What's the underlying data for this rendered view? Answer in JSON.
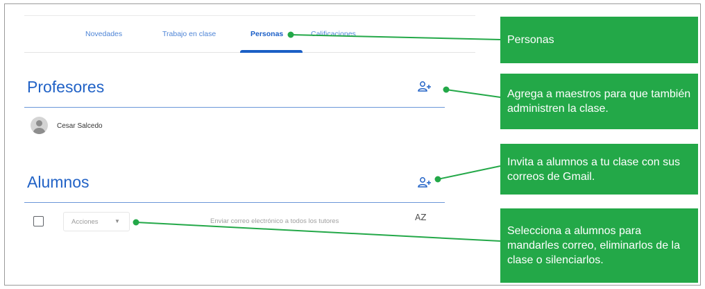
{
  "tabs": [
    {
      "label": "Novedades"
    },
    {
      "label": "Trabajo en clase"
    },
    {
      "label": "Personas"
    },
    {
      "label": "Calificaciones"
    }
  ],
  "teachers": {
    "title": "Profesores",
    "members": [
      {
        "name": "Cesar Salcedo"
      }
    ]
  },
  "students": {
    "title": "Alumnos",
    "actions_label": "Acciones",
    "email_all_label": "Enviar correo electrónico a todos los tutores",
    "sort_label": "AZ"
  },
  "callouts": [
    {
      "text": "Personas"
    },
    {
      "text": "Agrega a maestros para que también administren la clase."
    },
    {
      "text": "Invita a alumnos a tu clase con sus correos de Gmail."
    },
    {
      "text": "Selecciona a alumnos para mandarles correo, eliminarlos de la clase o silenciarlos."
    }
  ],
  "colors": {
    "accent": "#1a5ec7",
    "callout": "#23a848"
  }
}
